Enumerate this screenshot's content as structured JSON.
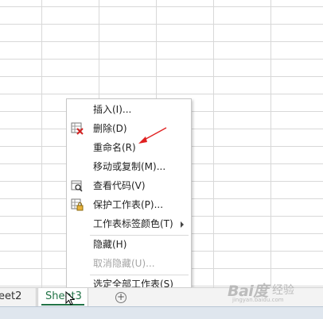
{
  "sheet_tabs": [
    {
      "label": "eet2",
      "active": false
    },
    {
      "label": "Sheet3",
      "active": true
    }
  ],
  "add_sheet_symbol": "+",
  "context_menu": {
    "items": [
      {
        "label": "插入(I)...",
        "enabled": true,
        "icon": null
      },
      {
        "label": "删除(D)",
        "enabled": true,
        "icon": "delete-sheet-icon"
      },
      {
        "label": "重命名(R)",
        "enabled": true,
        "icon": null
      },
      {
        "label": "移动或复制(M)...",
        "enabled": true,
        "icon": null
      },
      {
        "label": "查看代码(V)",
        "enabled": true,
        "icon": "view-code-icon"
      },
      {
        "label": "保护工作表(P)...",
        "enabled": true,
        "icon": "protect-sheet-icon"
      },
      {
        "label": "工作表标签颜色(T)",
        "enabled": true,
        "icon": null,
        "submenu": true
      },
      {
        "label": "隐藏(H)",
        "enabled": true,
        "icon": null
      },
      {
        "label": "取消隐藏(U)...",
        "enabled": false,
        "icon": null
      },
      {
        "label": "选定全部工作表(S)",
        "enabled": true,
        "icon": null
      }
    ]
  },
  "colors": {
    "accent": "#217346",
    "annotation_arrow": "#e02020",
    "disabled_text": "#a6a6a6"
  },
  "watermark": {
    "brand": "Bai度",
    "sub": "经验",
    "url": "jingyan.baidu.com"
  }
}
